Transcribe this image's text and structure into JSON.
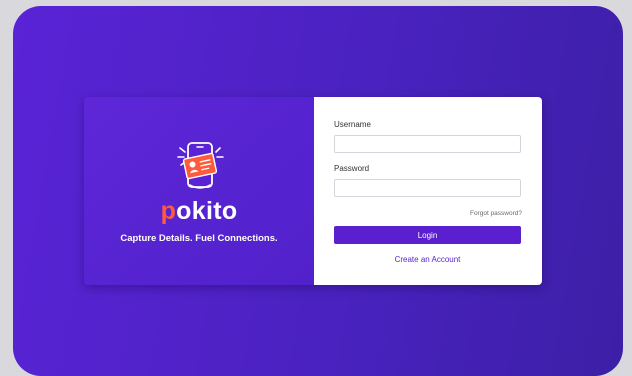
{
  "brand": {
    "name_first": "p",
    "name_rest": "okito",
    "tagline": "Capture Details. Fuel Connections.",
    "logo_icon": "id-card-phone-icon"
  },
  "form": {
    "username_label": "Username",
    "username_value": "",
    "password_label": "Password",
    "password_value": "",
    "forgot_label": "Forgot password?",
    "login_label": "Login",
    "create_label": "Create an Account"
  },
  "colors": {
    "background_purple": "#4a22c0",
    "panel_purple": "#5a23d6",
    "accent_orange": "#ff5a3c",
    "button_purple": "#5a1fcf"
  }
}
